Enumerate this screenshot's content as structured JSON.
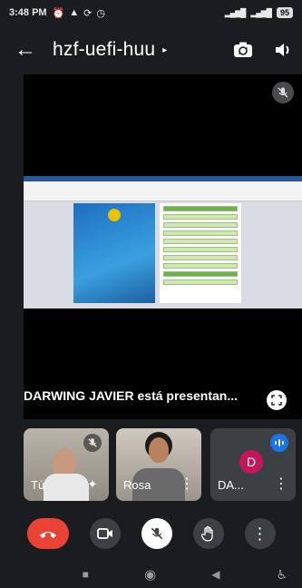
{
  "status_bar": {
    "time": "3:48 PM",
    "icons": [
      "alarm-icon",
      "warning-icon",
      "sync-icon",
      "clock-icon"
    ],
    "battery": "95"
  },
  "header": {
    "back_icon": "arrow-back-icon",
    "title": "hzf-uefi-huu",
    "icons": [
      "switch-camera-icon",
      "speaker-icon"
    ]
  },
  "presentation": {
    "presenter_text": "DARWING JAVIER está presentan..."
  },
  "participants": [
    {
      "name": "Tú",
      "muted": true
    },
    {
      "name": "Rosa"
    },
    {
      "name": "DA...",
      "avatar_letter": "D",
      "avatar_color": "#c2185b"
    }
  ],
  "controls": [
    "end-call",
    "camera",
    "microphone-muted",
    "raise-hand",
    "more-options"
  ],
  "colors": {
    "end_call": "#ea4335",
    "speaking_badge": "#1a73e8",
    "background": "#1b1c1f"
  }
}
